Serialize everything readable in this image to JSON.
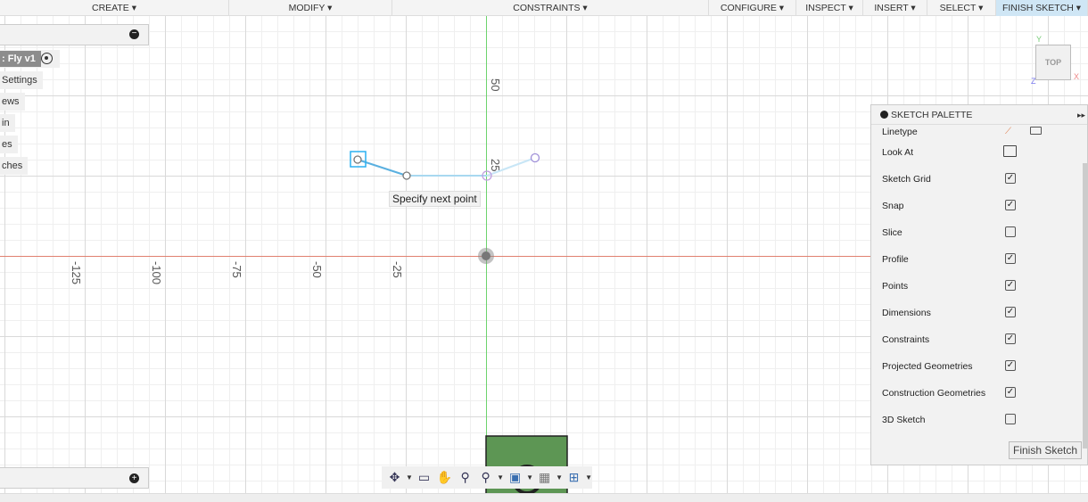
{
  "toolbar": {
    "items": [
      "CREATE ▾",
      "MODIFY ▾",
      "CONSTRAINTS ▾",
      "CONFIGURE ▾",
      "INSPECT ▾",
      "INSERT ▾",
      "SELECT ▾",
      "FINISH SKETCH ▾"
    ]
  },
  "browser": {
    "component": ": Fly v1",
    "items": [
      " Settings",
      "ews",
      "in",
      "es",
      "ches"
    ]
  },
  "axes": {
    "x_labels": [
      "-125",
      "-100",
      "-75",
      "-50",
      "-25"
    ],
    "y_labels": [
      "50",
      "25"
    ]
  },
  "tooltip": "Specify next point",
  "viewcube": {
    "face": "TOP",
    "x": "X",
    "y": "Y",
    "z": "Z"
  },
  "palette": {
    "title": "SKETCH PALETTE",
    "rows": [
      {
        "label": "Linetype"
      },
      {
        "label": "Look At"
      },
      {
        "label": "Sketch Grid",
        "checked": true
      },
      {
        "label": "Snap",
        "checked": true
      },
      {
        "label": "Slice",
        "checked": false
      },
      {
        "label": "Profile",
        "checked": true
      },
      {
        "label": "Points",
        "checked": true
      },
      {
        "label": "Dimensions",
        "checked": true
      },
      {
        "label": "Constraints",
        "checked": true
      },
      {
        "label": "Projected Geometries",
        "checked": true
      },
      {
        "label": "Construction Geometries",
        "checked": true
      },
      {
        "label": "3D Sketch",
        "checked": false
      }
    ],
    "finish": "Finish Sketch"
  }
}
